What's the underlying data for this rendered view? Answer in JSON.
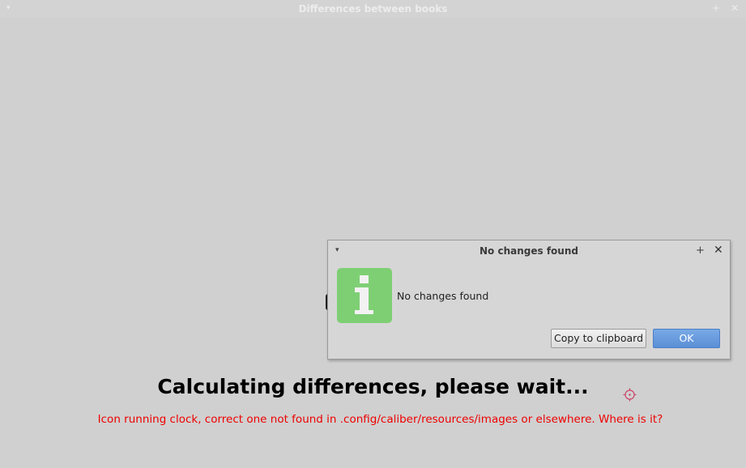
{
  "main_window": {
    "title": "Differences between books",
    "menu_glyph": "▾",
    "pin_glyph": "+",
    "close_glyph": "✕"
  },
  "progress": {
    "heading": "Calculating differences, please wait...",
    "error": "Icon running clock, correct one not found in .config/caliber/resources/images or elsewhere. Where is it?",
    "clock_icon": "clock-icon"
  },
  "dialog": {
    "title": "No changes found",
    "menu_glyph": "▾",
    "pin_glyph": "+",
    "close_glyph": "✕",
    "icon": "info-icon",
    "message": "No changes found",
    "copy_button": "Copy to clipboard",
    "ok_button": "OK"
  },
  "colors": {
    "background": "#d0d0d0",
    "info_green": "#7ecf74",
    "error_red": "#ee0000",
    "ok_blue": "#5b8fd6"
  }
}
